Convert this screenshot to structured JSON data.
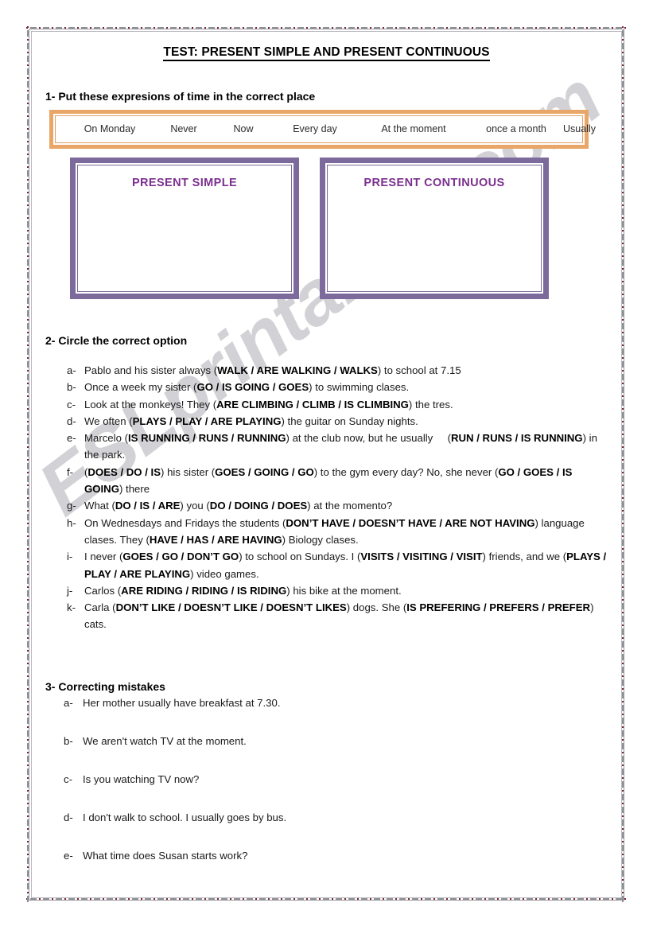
{
  "document": {
    "title": "TEST: PRESENT SIMPLE AND PRESENT CONTINUOUS",
    "watermark": "ESLprintables.com"
  },
  "colors": {
    "expression_box_border": "#e8a768",
    "category_box_border": "#7c6a9c",
    "category_title": "#7b2f8e",
    "page_border_dot": "#7a2430",
    "page_border_dash": "#8f8f96",
    "watermark": "#d2d2d6"
  },
  "exercise1": {
    "heading": "1- Put these expresions of time in the correct place",
    "expressions": [
      "On Monday",
      "Never",
      "Now",
      "Every day",
      "At the moment",
      "once a month",
      "Usually"
    ],
    "categories": [
      {
        "title": "PRESENT SIMPLE",
        "answers": ""
      },
      {
        "title": "PRESENT CONTINUOUS",
        "answers": ""
      }
    ]
  },
  "exercise2": {
    "heading": "2- Circle the correct option",
    "items": [
      {
        "label": "a-",
        "html": "Pablo and his sister always (<b>WALK / ARE WALKING / WALKS</b>) to school at 7.15"
      },
      {
        "label": "b-",
        "html": "Once a week my sister (<b>GO / IS GOING / GOES</b>) to swimming clases."
      },
      {
        "label": "c-",
        "html": "Look at the monkeys! They (<b>ARE CLIMBING / CLIMB / IS CLIMBING</b>) the tres."
      },
      {
        "label": "d-",
        "html": "We often (<b>PLAYS / PLAY / ARE PLAYING</b>) the guitar on Sunday nights."
      },
      {
        "label": "e-",
        "html": "Marcelo (<b>IS RUNNING / RUNS / RUNNING</b>) at the club now, but he usually &nbsp;&nbsp;&nbsp; (<b>RUN / RUNS / IS RUNNING</b>) in the park."
      },
      {
        "label": "f-",
        "html": "(<b>DOES / DO / IS</b>) his sister (<b>GOES / GOING / GO</b>) to the gym every day? No, she never (<b>GO / GOES / IS GOING</b>) there"
      },
      {
        "label": "g-",
        "html": "What (<b>DO / IS / ARE</b>) you (<b>DO / DOING / DOES</b>) at the momento?"
      },
      {
        "label": "h-",
        "html": "On Wednesdays and Fridays the students (<b>DON&rsquo;T HAVE / DOESN&rsquo;T HAVE / ARE NOT HAVING</b>) language clases. They (<b>HAVE / HAS / ARE HAVING</b>) Biology clases."
      },
      {
        "label": "i-",
        "html": "I never (<b>GOES / GO / DON&rsquo;T GO</b>) to school on Sundays. I (<b>VISITS / VISITING / VISIT</b>) friends, and we (<b>PLAYS / PLAY / ARE PLAYING</b>) video games."
      },
      {
        "label": "j-",
        "html": "Carlos (<b>ARE RIDING / RIDING / IS RIDING</b>) his bike at the moment."
      },
      {
        "label": "k-",
        "html": "Carla (<b>DON&rsquo;T LIKE / DOESN&rsquo;T LIKE / DOESN&rsquo;T LIKES</b>) dogs. She (<b>IS PREFERING / PREFERS / PREFER</b>) cats."
      }
    ]
  },
  "exercise3": {
    "heading": "3- Correcting mistakes",
    "items": [
      {
        "label": "a-",
        "text": "Her mother usually have breakfast at 7.30."
      },
      {
        "label": "b-",
        "text": "We aren't watch TV at the moment."
      },
      {
        "label": "c-",
        "text": "Is you watching TV now?"
      },
      {
        "label": "d-",
        "text": "I don't walk to school. I usually goes by bus."
      },
      {
        "label": "e-",
        "text": "What time does Susan starts work?"
      }
    ]
  }
}
